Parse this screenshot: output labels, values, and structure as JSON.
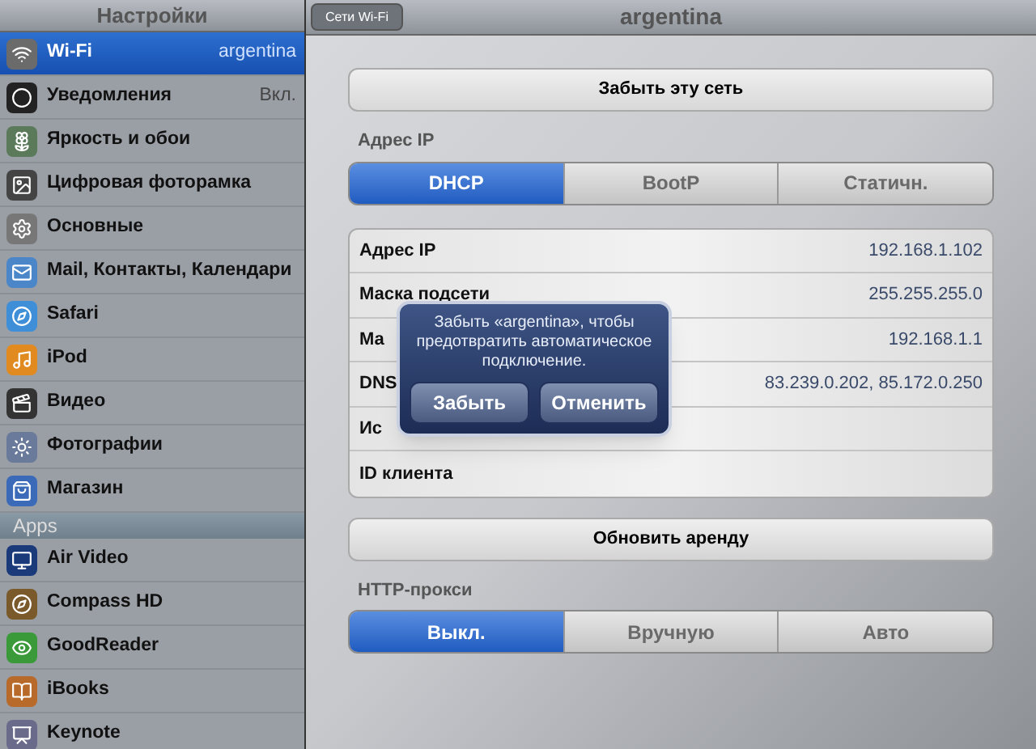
{
  "sidebar": {
    "title": "Настройки",
    "sections": [
      {
        "items": [
          {
            "label": "Wi-Fi",
            "value": "argentina",
            "selected": true
          },
          {
            "label": "Уведомления",
            "value": "Вкл.",
            "selected": false
          },
          {
            "label": "Яркость и обои",
            "selected": false
          },
          {
            "label": "Цифровая фоторамка",
            "selected": false
          },
          {
            "label": "Основные",
            "selected": false
          },
          {
            "label": "Mail, Контакты, Календари",
            "selected": false
          },
          {
            "label": "Safari",
            "selected": false
          },
          {
            "label": "iPod",
            "selected": false
          },
          {
            "label": "Видео",
            "selected": false
          },
          {
            "label": "Фотографии",
            "selected": false
          },
          {
            "label": "Магазин",
            "selected": false
          }
        ]
      },
      {
        "header": "Apps",
        "items": [
          {
            "label": "Air Video",
            "selected": false
          },
          {
            "label": "Compass HD",
            "selected": false
          },
          {
            "label": "GoodReader",
            "selected": false
          },
          {
            "label": "iBooks",
            "selected": false
          },
          {
            "label": "Keynote",
            "selected": false
          }
        ]
      }
    ]
  },
  "detail": {
    "back_button": "Сети Wi-Fi",
    "title": "argentina",
    "forget_button": "Забыть эту сеть",
    "ip_section": {
      "label": "Адрес IP",
      "options": [
        {
          "label": "DHCP",
          "selected": true
        },
        {
          "label": "BootP",
          "selected": false
        },
        {
          "label": "Статичн.",
          "selected": false
        }
      ]
    },
    "rows": [
      {
        "label": "Адрес IP",
        "value": "192.168.1.102"
      },
      {
        "label": "Маска подсети",
        "value": "255.255.255.0"
      },
      {
        "label": "Ма",
        "value": "192.168.1.1"
      },
      {
        "label": "DNS",
        "value": "83.239.0.202, 85.172.0.250"
      },
      {
        "label": "Ис"
      },
      {
        "label": "ID клиента"
      }
    ],
    "renew_button": "Обновить аренду",
    "proxy_section": {
      "label": "HTTP-прокси",
      "options": [
        {
          "label": "Выкл.",
          "selected": true
        },
        {
          "label": "Вручную",
          "selected": false
        },
        {
          "label": "Авто",
          "selected": false
        }
      ]
    }
  },
  "alert": {
    "message": "Забыть «argentina», чтобы предотвратить автоматическое подключение.",
    "buttons": [
      "Забыть",
      "Отменить"
    ]
  }
}
